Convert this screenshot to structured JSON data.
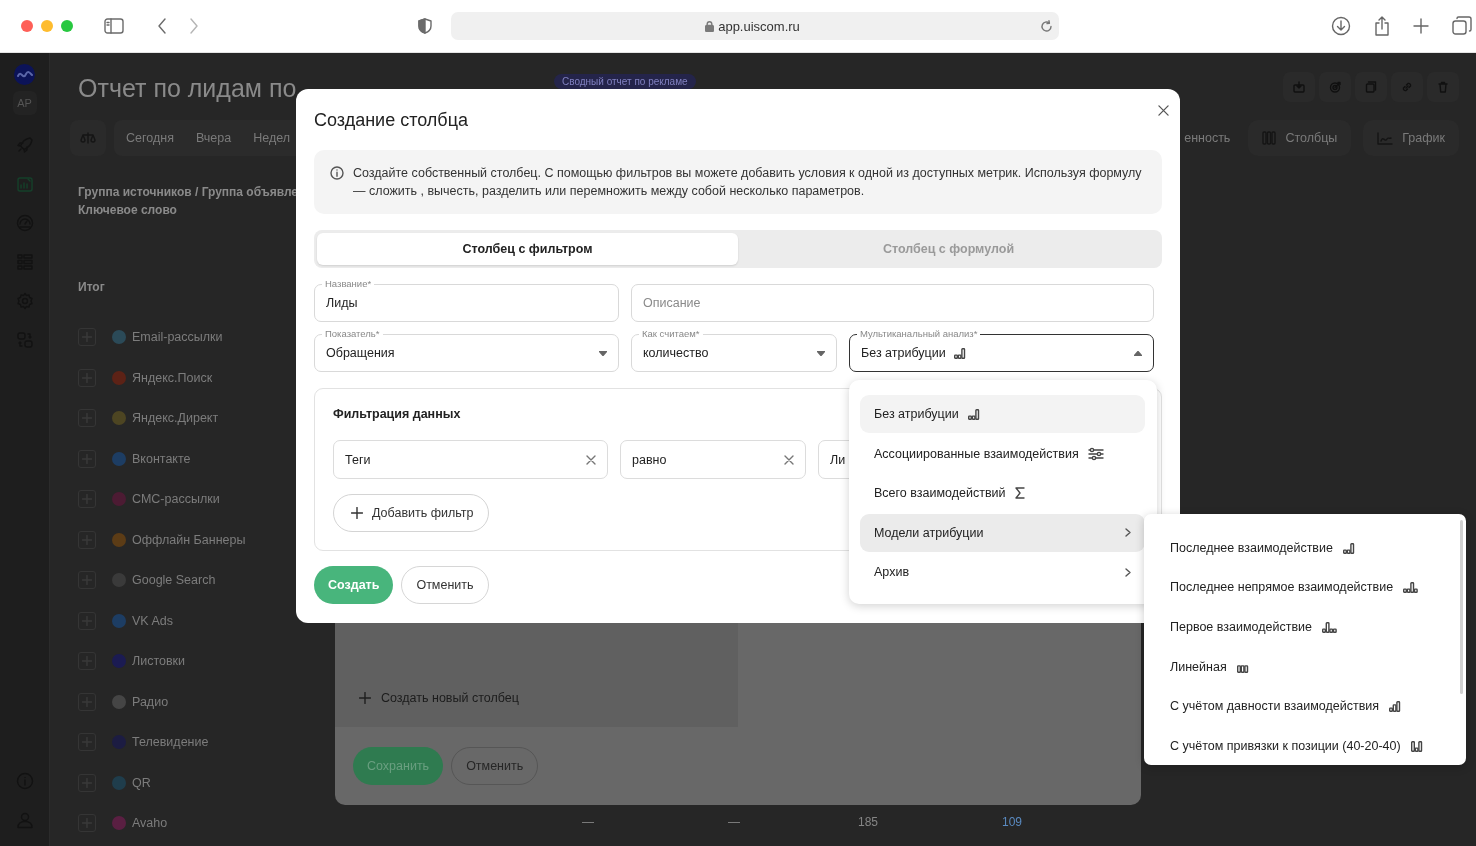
{
  "browser": {
    "url": "app.uiscom.ru"
  },
  "rail": {
    "avatar": "AP"
  },
  "page": {
    "title": "Отчет по лидам по",
    "badge": "Сводный отчет по рекламе",
    "periods": [
      "Сегодня",
      "Вчера",
      "Недел"
    ],
    "tools": [
      {
        "label": "енность",
        "kind": "text"
      },
      {
        "label": "Столбцы",
        "kind": "columns"
      },
      {
        "label": "График",
        "kind": "chart"
      }
    ],
    "header": [
      "Группа источников / Группа объявле",
      "Ключевое слово"
    ],
    "total_label": "Итог",
    "rows": [
      {
        "name": "Email-рассылки",
        "color": "#2b4a58"
      },
      {
        "name": "Яндекс.Поиск",
        "color": "#5c2216"
      },
      {
        "name": "Яндекс.Директ",
        "color": "#4d4522"
      },
      {
        "name": "Вконтакте",
        "color": "#1d3d63"
      },
      {
        "name": "СМС-рассылки",
        "color": "#4c1b33"
      },
      {
        "name": "Оффлайн Баннеры",
        "color": "#5c3c16"
      },
      {
        "name": "Google Search",
        "color": "#3a3a3a"
      },
      {
        "name": "VK Ads",
        "color": "#1d3d63"
      },
      {
        "name": "Листовки",
        "color": "#1b1b52"
      },
      {
        "name": "Радио",
        "color": "#454545"
      },
      {
        "name": "Телевидение",
        "color": "#1c1c42"
      },
      {
        "name": "QR",
        "color": "#1f3d4c"
      },
      {
        "name": "Avaho",
        "color": "#5a1f42",
        "values": [
          {
            "text": "—",
            "kind": "plain"
          },
          {
            "text": "—",
            "kind": "plain"
          },
          {
            "text": "185",
            "kind": "plain"
          },
          {
            "text": "109",
            "kind": "link"
          }
        ]
      }
    ]
  },
  "columns_panel": {
    "add_label": "Создать новый столбец",
    "buttons": [
      {
        "label": "Сохранить",
        "kind": "primary"
      },
      {
        "label": "Отменить",
        "kind": "secondary"
      }
    ]
  },
  "modal": {
    "title": "Создание столбца",
    "info": "Создайте собственный столбец. С помощью фильтров вы можете добавить условия к одной из доступных метрик. Используя формулу — сложить , вычесть, разделить или перемножить между собой несколько параметров.",
    "tabs": [
      {
        "label": "Столбец с фильтром",
        "selected": true
      },
      {
        "label": "Столбец с формулой",
        "selected": false
      }
    ],
    "fields": [
      {
        "kind": "text",
        "label": "Название*",
        "value": "Лиды"
      },
      {
        "kind": "text",
        "placeholder": "Описание"
      },
      {
        "kind": "select",
        "label": "Показатель*",
        "value": "Обращения",
        "open": false
      },
      {
        "kind": "select",
        "label": "Как считаем*",
        "value": "количество",
        "open": false
      },
      {
        "kind": "attribution",
        "label": "Мультиканальный анализ*",
        "value": "Без атрибуции",
        "open": true
      }
    ],
    "filter": {
      "title": "Фильтрация данных",
      "conditions": [
        {
          "value": "Теги",
          "clearable": true
        },
        {
          "value": "равно",
          "clearable": true
        },
        {
          "value": "Ли",
          "clearable": false
        }
      ],
      "add_label": "Добавить фильтр"
    },
    "buttons": [
      {
        "label": "Создать",
        "kind": "primary"
      },
      {
        "label": "Отменить",
        "kind": "secondary"
      }
    ],
    "menu": [
      {
        "label": "Без атрибуции",
        "selected": true,
        "expanded": false,
        "has_submenu": false
      },
      {
        "label": "Ассоциированные взаимодействия",
        "selected": false,
        "expanded": false,
        "has_submenu": false
      },
      {
        "label": "Всего взаимодействий",
        "selected": false,
        "expanded": false,
        "has_submenu": false
      },
      {
        "label": "Модели атрибуции",
        "selected": false,
        "expanded": true,
        "has_submenu": true
      },
      {
        "label": "Архив",
        "selected": false,
        "expanded": false,
        "has_submenu": true
      }
    ],
    "submenu": [
      "Последнее взаимодействие",
      "Последнее непрямое взаимодействие",
      "Первое взаимодействие",
      "Линейная",
      "С учётом давности взаимодействия",
      "С учётом привязки к позиции (40-20-40)"
    ]
  }
}
